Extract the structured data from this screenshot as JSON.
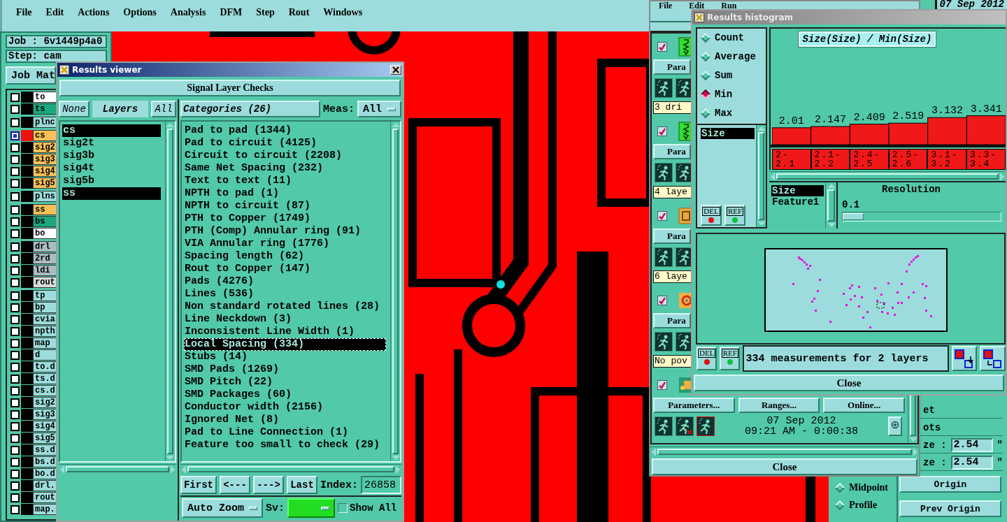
{
  "main_window": {
    "menu": [
      "File",
      "Edit",
      "Actions",
      "Options",
      "Analysis",
      "DFM",
      "Step",
      "Rout",
      "Windows"
    ],
    "job": "Job : 6v1449p4a0",
    "step": "Step: cam",
    "job_matrix_button": "Job Mat",
    "layer_groups": [
      {
        "layers": [
          {
            "name": "to",
            "color": "#ffffff",
            "selected": false
          },
          {
            "name": "ts",
            "color": "#1aa87e",
            "selected": false
          }
        ]
      },
      {
        "layers": [
          {
            "name": "plnc",
            "color": "#9cdcdc",
            "selected": false
          }
        ]
      },
      {
        "layers": [
          {
            "name": "cs",
            "color": "#f8c058",
            "selected": true
          },
          {
            "name": "sig2",
            "color": "#f8c058",
            "selected": false
          },
          {
            "name": "sig3",
            "color": "#f8c058",
            "selected": false
          },
          {
            "name": "sig4",
            "color": "#f8c058",
            "selected": false
          },
          {
            "name": "sig5",
            "color": "#f8c058",
            "selected": false
          }
        ]
      },
      {
        "layers": [
          {
            "name": "plns",
            "color": "#9cdcdc",
            "selected": false
          }
        ]
      },
      {
        "layers": [
          {
            "name": "ss",
            "color": "#f8c058",
            "selected": false
          },
          {
            "name": "bs",
            "color": "#1aa87e",
            "selected": false
          },
          {
            "name": "bo",
            "color": "#ffffff",
            "selected": false
          }
        ]
      },
      {
        "layers": [
          {
            "name": "drl",
            "color": "#a8bcc4",
            "selected": false
          },
          {
            "name": "2rd",
            "color": "#a8bcc4",
            "selected": false
          },
          {
            "name": "ldi",
            "color": "#a8bcc4",
            "selected": false
          },
          {
            "name": "rout",
            "color": "#d8dcdc",
            "selected": false
          }
        ]
      },
      {
        "layers": [
          {
            "name": "tp",
            "color": "#9cdcdc",
            "selected": false
          },
          {
            "name": "bp",
            "color": "#9cdcdc",
            "selected": false
          },
          {
            "name": "cvia",
            "color": "#9cdcdc",
            "selected": false
          },
          {
            "name": "npth",
            "color": "#9cdcdc",
            "selected": false
          },
          {
            "name": "map",
            "color": "#9cdcdc",
            "selected": false
          },
          {
            "name": "d",
            "color": "#9cdcdc",
            "selected": false
          },
          {
            "name": "to.d",
            "color": "#9cdcdc",
            "selected": false
          },
          {
            "name": "ts.d",
            "color": "#9cdcdc",
            "selected": false
          },
          {
            "name": "cs.d",
            "color": "#9cdcdc",
            "selected": false
          },
          {
            "name": "sig2",
            "color": "#9cdcdc",
            "selected": false
          },
          {
            "name": "sig3",
            "color": "#9cdcdc",
            "selected": false
          },
          {
            "name": "sig4",
            "color": "#9cdcdc",
            "selected": false
          },
          {
            "name": "sig5",
            "color": "#9cdcdc",
            "selected": false
          },
          {
            "name": "ss.d",
            "color": "#9cdcdc",
            "selected": false
          },
          {
            "name": "bs.d",
            "color": "#9cdcdc",
            "selected": false
          },
          {
            "name": "bo.d",
            "color": "#9cdcdc",
            "selected": false
          },
          {
            "name": "drl.",
            "color": "#9cdcdc",
            "selected": false
          },
          {
            "name": "rout",
            "color": "#9cdcdc",
            "selected": false
          },
          {
            "name": "map.",
            "color": "#9cdcdc",
            "selected": false
          }
        ]
      }
    ]
  },
  "results_viewer": {
    "title": "Results viewer",
    "section_button": "Signal Layer Checks",
    "none_button": "None",
    "layers_label": "Layers",
    "all_button": "All",
    "layers": [
      {
        "name": "cs",
        "selected": true
      },
      {
        "name": "sig2t",
        "selected": false
      },
      {
        "name": "sig3b",
        "selected": false
      },
      {
        "name": "sig4t",
        "selected": false
      },
      {
        "name": "sig5b",
        "selected": false
      },
      {
        "name": "ss",
        "selected": true
      }
    ],
    "categories_button": "Categories (26)",
    "meas_label": "Meas:",
    "meas_value": "All",
    "categories": [
      {
        "label": "Pad to pad (1344)",
        "selected": false
      },
      {
        "label": "Pad to circuit (4125)",
        "selected": false
      },
      {
        "label": "Circuit to circuit (2208)",
        "selected": false
      },
      {
        "label": "Same Net Spacing (232)",
        "selected": false
      },
      {
        "label": "Text to text (11)",
        "selected": false
      },
      {
        "label": "NPTH to pad (1)",
        "selected": false
      },
      {
        "label": "NPTH to circuit (87)",
        "selected": false
      },
      {
        "label": "PTH to Copper (1749)",
        "selected": false
      },
      {
        "label": "PTH (Comp) Annular ring (91)",
        "selected": false
      },
      {
        "label": "VIA Annular ring (1776)",
        "selected": false
      },
      {
        "label": "Spacing length (62)",
        "selected": false
      },
      {
        "label": "Rout to Copper (147)",
        "selected": false
      },
      {
        "label": "Pads (4276)",
        "selected": false
      },
      {
        "label": "Lines (536)",
        "selected": false
      },
      {
        "label": "Non standard rotated lines (28)",
        "selected": false
      },
      {
        "label": "Line Neckdown (3)",
        "selected": false
      },
      {
        "label": "Inconsistent Line Width (1)",
        "selected": false
      },
      {
        "label": "Local Spacing (334)",
        "selected": true
      },
      {
        "label": "Stubs (14)",
        "selected": false
      },
      {
        "label": "SMD Pads (1269)",
        "selected": false
      },
      {
        "label": "SMD Pitch (22)",
        "selected": false
      },
      {
        "label": "SMD Packages (60)",
        "selected": false
      },
      {
        "label": "Conductor width (2156)",
        "selected": false
      },
      {
        "label": "Ignored Net (8)",
        "selected": false
      },
      {
        "label": "Pad to Line Connection (1)",
        "selected": false
      },
      {
        "label": "Feature too small to check (29)",
        "selected": false
      }
    ],
    "nav_buttons": [
      "First",
      "<---",
      "--->",
      "Last"
    ],
    "index_label": "Index:",
    "index_value": "26858",
    "zoom_value": "Auto Zoom",
    "sv": {
      "label": "Sv:",
      "color": "#22dd22"
    },
    "show_all": {
      "label": "Show All",
      "checked": false
    }
  },
  "check_window": {
    "menu": [
      "File",
      "Edit",
      "Run"
    ],
    "actions": [
      {
        "kind": "drill",
        "checked": true,
        "button": "Para",
        "status": "3 dri"
      },
      {
        "kind": "drill",
        "checked": true,
        "button": "Para",
        "status": "4 laye"
      },
      {
        "kind": "chip",
        "checked": true,
        "button": "Para",
        "status": "6 laye"
      },
      {
        "kind": "target",
        "checked": true,
        "button": "Para",
        "status": "No pov"
      },
      {
        "kind": "board",
        "checked": true,
        "buttons": [
          "Parameters...",
          "Ranges...",
          "Online..."
        ],
        "date": "07 Sep 2012",
        "time": "09:21 AM - 0:00:38"
      }
    ],
    "close": "Close"
  },
  "side_window": {
    "date": "07 Sep 2012",
    "labels": [
      "et",
      "ots"
    ],
    "fields": [
      {
        "label": "ze :",
        "value": "2.54",
        "unit": "\""
      },
      {
        "label": "ze :",
        "value": "2.54",
        "unit": "\""
      }
    ],
    "options": [
      {
        "label": "Midpoint",
        "selected": false
      },
      {
        "label": "Profile",
        "selected": false
      }
    ],
    "buttons": [
      "Origin",
      "Prev Origin"
    ]
  },
  "histogram": {
    "title": "Results histogram",
    "modes": [
      {
        "label": "Count",
        "selected": false
      },
      {
        "label": "Average",
        "selected": false
      },
      {
        "label": "Sum",
        "selected": false
      },
      {
        "label": "Min",
        "selected": true
      },
      {
        "label": "Max",
        "selected": false
      }
    ],
    "fields": [
      {
        "label": "Size",
        "selected": true
      }
    ],
    "del_button": "DEL",
    "ref_button": "REF",
    "chart_data": {
      "type": "bar",
      "title": "Size(Size) / Min(Size)",
      "categories": [
        "2-2.1",
        "2.1-2.2",
        "2.4-2.5",
        "2.5-2.6",
        "3.1-3.2",
        "3.3-3.4"
      ],
      "values": [
        2.01,
        2.147,
        2.409,
        2.519,
        3.132,
        3.341
      ],
      "data_labels": true
    },
    "attributes": [
      {
        "label": "Size",
        "selected": true
      },
      {
        "label": "Feature1",
        "selected": false
      }
    ],
    "resolution_label": "Resolution",
    "resolution_value": "0.1",
    "resolution_slider": {
      "level": 0
    },
    "status_del": "DEL",
    "status_ref": "REF",
    "status": "334 measurements for 2 layers",
    "close": "Close"
  }
}
